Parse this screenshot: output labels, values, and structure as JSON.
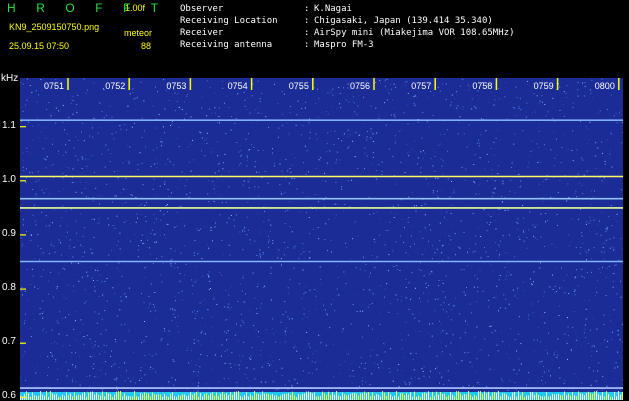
{
  "header": {
    "brand": "H R O F F T",
    "version": "1.00f",
    "filename": "KN9_2509150750.png",
    "meteor_label": "meteor",
    "datetime": "25.09.15 07:50",
    "meteor_count": "88"
  },
  "meta": [
    {
      "key": "Observer",
      "sep": ":",
      "value": "K.Nagai"
    },
    {
      "key": "Receiving Location",
      "sep": ":",
      "value": "Chigasaki, Japan (139.414 35.340)"
    },
    {
      "key": "Receiver",
      "sep": ":",
      "value": "AirSpy mini (Miakejima VOR 108.65MHz)"
    },
    {
      "key": "Receiving antenna",
      "sep": ":",
      "value": "Maspro FM-3"
    }
  ],
  "spectrogram": {
    "unit": "kHz",
    "y_ticks": [
      "1.1",
      "1.0",
      "0.9",
      "0.8",
      "0.7",
      "0.6"
    ],
    "x_ticks": [
      "0751",
      "0752",
      "0753",
      "0754",
      "0755",
      "0756",
      "0757",
      "0758",
      "0759",
      "0800"
    ],
    "y_range_khz": [
      0.595,
      1.19
    ],
    "background_color": "#1b2c96",
    "tick_color": "#ffff00",
    "carrier_lines": [
      {
        "freq_khz": 1.112,
        "color": "#7fb0ff"
      },
      {
        "freq_khz": 1.008,
        "color": "#ffff60"
      },
      {
        "freq_khz": 0.967,
        "color": "#8fc0ff"
      },
      {
        "freq_khz": 0.95,
        "color": "#e8ff9a"
      },
      {
        "freq_khz": 0.851,
        "color": "#7fb4ff"
      },
      {
        "freq_khz": 0.617,
        "color": "#b0c8ff"
      },
      {
        "freq_khz": 0.6,
        "color": "#c8d8ff"
      }
    ]
  }
}
